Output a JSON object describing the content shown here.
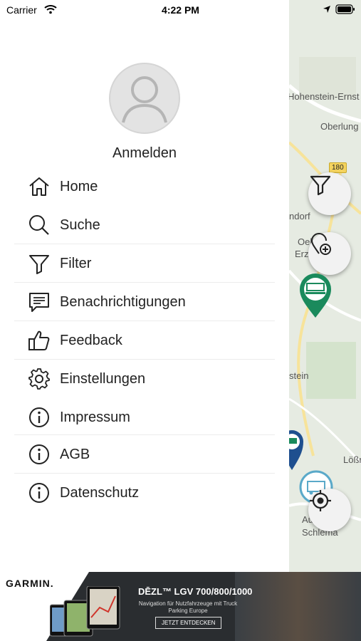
{
  "status_bar": {
    "carrier": "Carrier",
    "time": "4:22 PM"
  },
  "drawer": {
    "login_label": "Anmelden",
    "menu": [
      {
        "label": "Home",
        "icon": "home-icon"
      },
      {
        "label": "Suche",
        "icon": "search-icon"
      },
      {
        "label": "Filter",
        "icon": "filter-icon"
      },
      {
        "label": "Benachrichtigungen",
        "icon": "message-icon"
      },
      {
        "label": "Feedback",
        "icon": "thumbs-up-icon"
      },
      {
        "label": "Einstellungen",
        "icon": "gear-icon"
      },
      {
        "label": "Impressum",
        "icon": "info-icon"
      },
      {
        "label": "AGB",
        "icon": "info-icon"
      },
      {
        "label": "Datenschutz",
        "icon": "info-icon"
      }
    ]
  },
  "map": {
    "labels": [
      "Hohenstein-Ernst",
      "Oberlung",
      "ndorf",
      "Oel",
      "Erz",
      "stein",
      "Lößn",
      "Au",
      "Schlema"
    ],
    "road_badge": "180",
    "colors": {
      "marker_green": "#1a8a5c",
      "marker_blue": "#1e4f8f",
      "marker_light_blue": "#5aa9c9"
    }
  },
  "ad": {
    "brand": "GARMIN.",
    "title": "DĒZL™ LGV 700/800/1000",
    "subtitle": "Navigation für Nutzfahrzeuge mit Truck Parking Europe",
    "cta": "JETZT ENTDECKEN"
  }
}
